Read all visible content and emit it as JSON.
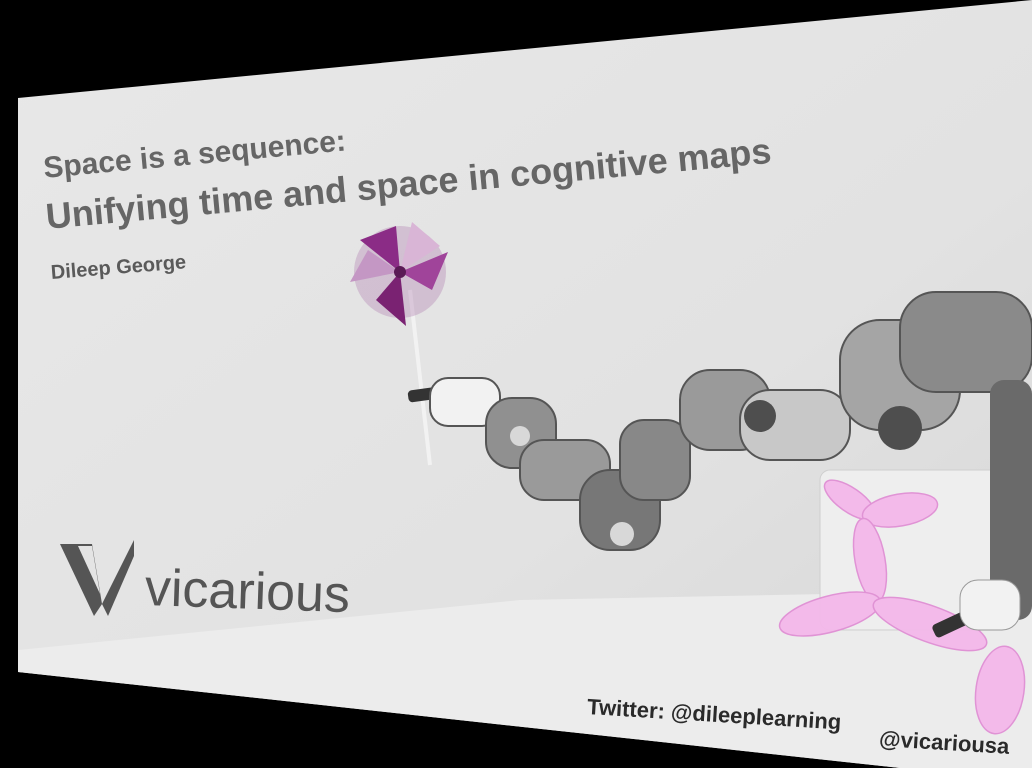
{
  "slide": {
    "title_line1": "Space is a sequence:",
    "title_line2": "Unifying time and space in cognitive maps",
    "author": "Dileep George",
    "logo_text": "vicarious",
    "twitter_label": "Twitter: @dileeplearning",
    "twitter_handle2": "@vicariousa"
  },
  "colors": {
    "background": "#000000",
    "slide": "#e4e4e4",
    "title_text": "#666666",
    "robot_gray": "#8a8a8a",
    "pinwheel": "#8b2c86",
    "balloon": "#f4b8ea"
  }
}
